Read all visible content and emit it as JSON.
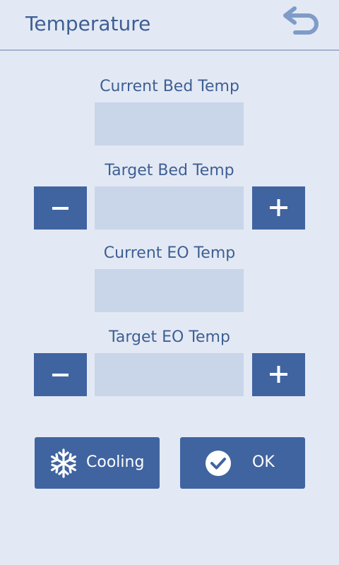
{
  "header": {
    "title": "Temperature",
    "back_icon": "undo-arrow-icon"
  },
  "fields": {
    "current_bed": {
      "label": "Current Bed Temp",
      "value": ""
    },
    "target_bed": {
      "label": "Target Bed Temp",
      "value": ""
    },
    "current_eo": {
      "label": "Current EO Temp",
      "value": ""
    },
    "target_eo": {
      "label": "Target EO Temp",
      "value": ""
    }
  },
  "steppers": {
    "decrease_icon": "minus-icon",
    "increase_icon": "plus-icon"
  },
  "actions": {
    "cooling": {
      "label": "Cooling",
      "icon": "snowflake-icon"
    },
    "ok": {
      "label": "OK",
      "icon": "check-circle-icon"
    }
  },
  "colors": {
    "background": "#e3e9f4",
    "accent": "#4064a0",
    "field": "#c9d5e8",
    "text": "#3e5f94",
    "divider": "#9fb2d2",
    "back_icon": "#7f9cc8"
  }
}
